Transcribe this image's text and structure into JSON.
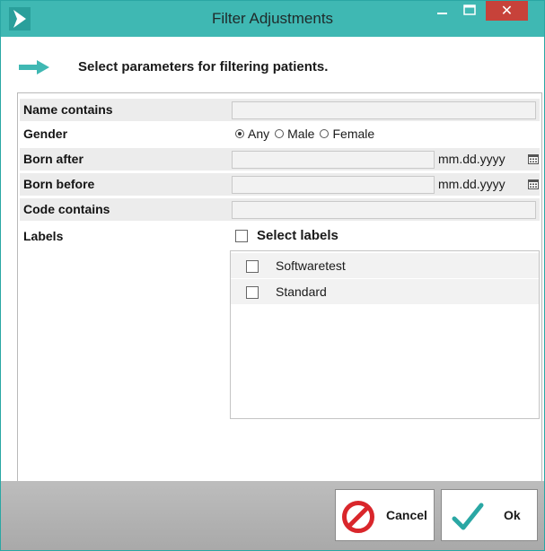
{
  "window": {
    "title": "Filter Adjustments",
    "close_glyph": "✕",
    "accent_color": "#3fb8b3"
  },
  "header": {
    "icon": "arrow-right-icon",
    "text": "Select parameters for filtering patients."
  },
  "form": {
    "name_label": "Name contains",
    "name_value": "",
    "gender_label": "Gender",
    "gender_options": [
      "Any",
      "Male",
      "Female"
    ],
    "gender_selected": "Any",
    "born_after_label": "Born after",
    "born_after_value": "",
    "born_after_format": "mm.dd.yyyy",
    "born_before_label": "Born before",
    "born_before_value": "",
    "born_before_format": "mm.dd.yyyy",
    "code_label": "Code contains",
    "code_value": "",
    "labels_label": "Labels",
    "select_labels_text": "Select labels",
    "label_items": [
      "Softwaretest",
      "Standard"
    ]
  },
  "footer": {
    "cancel_label": "Cancel",
    "ok_label": "Ok"
  }
}
